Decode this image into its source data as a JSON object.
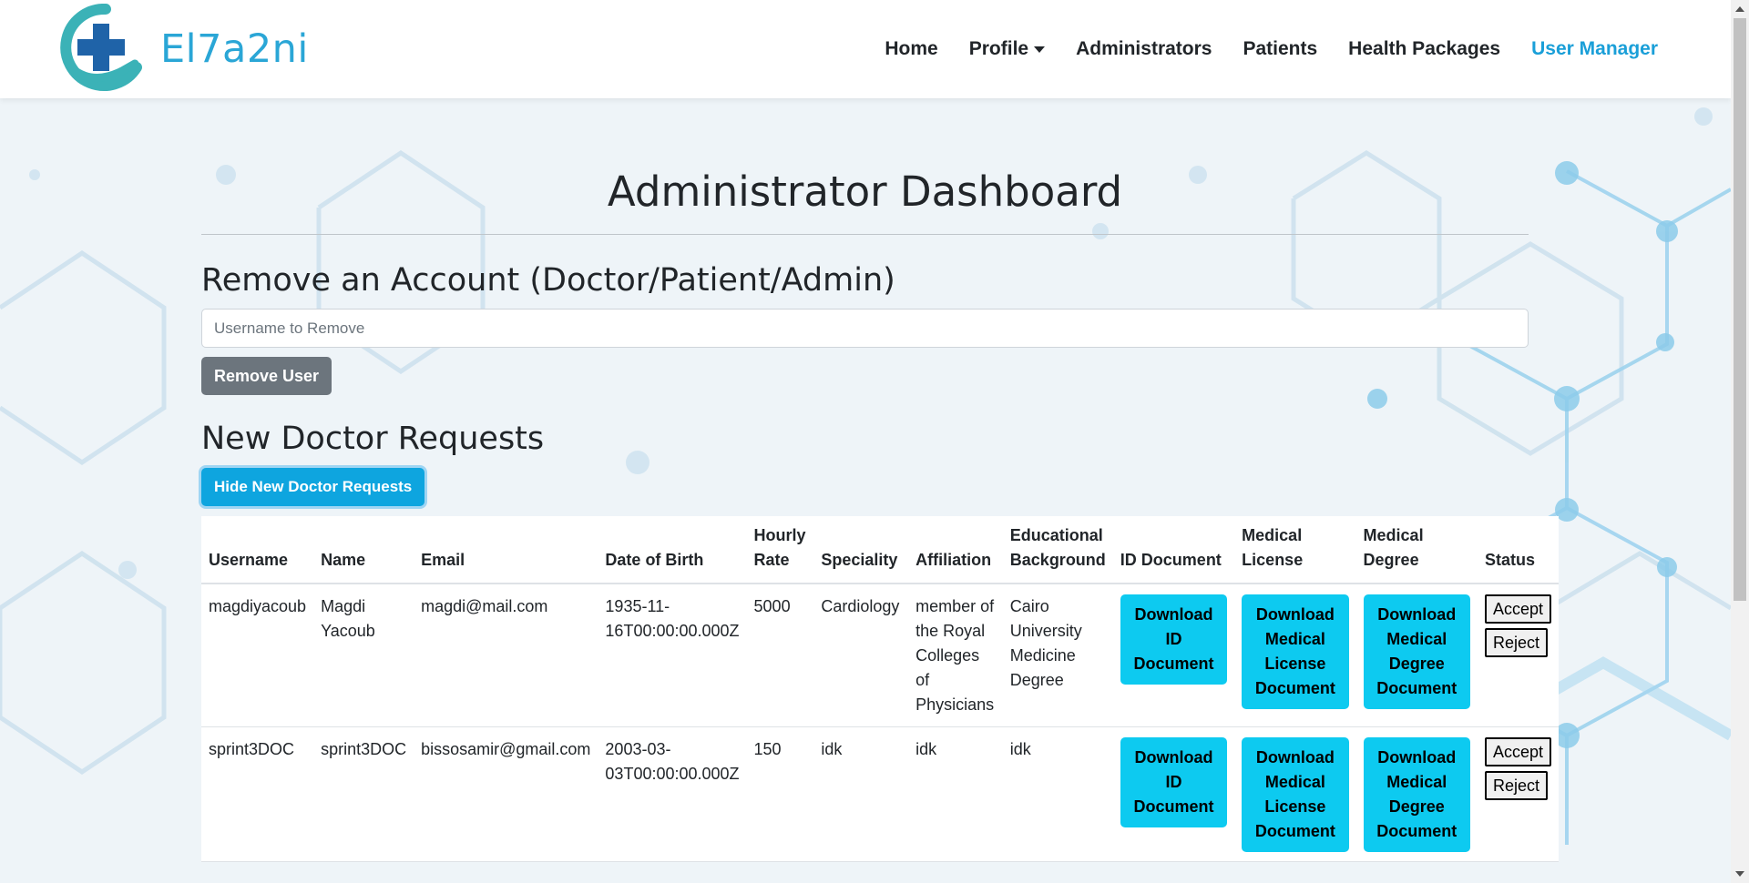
{
  "brand": {
    "name": "El7a2ni",
    "logo_icon": "medical-cross-hand-icon"
  },
  "nav": {
    "home": "Home",
    "profile": "Profile",
    "administrators": "Administrators",
    "patients": "Patients",
    "health_packages": "Health Packages",
    "user_manager": "User Manager"
  },
  "page": {
    "title": "Administrator Dashboard",
    "remove_section": {
      "heading": "Remove an Account (Doctor/Patient/Admin)",
      "input_placeholder": "Username to Remove",
      "input_value": "",
      "button": "Remove User"
    },
    "requests_section": {
      "heading": "New Doctor Requests",
      "toggle_button": "Hide New Doctor Requests"
    }
  },
  "table": {
    "headers": {
      "username": "Username",
      "name": "Name",
      "email": "Email",
      "dob": "Date of Birth",
      "rate": "Hourly Rate",
      "speciality": "Speciality",
      "affiliation": "Affiliation",
      "education": "Educational Background",
      "id_doc": "ID Document",
      "license": "Medical License",
      "degree": "Medical Degree",
      "status": "Status"
    },
    "buttons": {
      "download_id": "Download ID Document",
      "download_license": "Download Medical License Document",
      "download_degree": "Download Medical Degree Document",
      "accept": "Accept",
      "reject": "Reject"
    },
    "rows": [
      {
        "username": "magdiyacoub",
        "name": "Magdi Yacoub",
        "email": "magdi@mail.com",
        "dob": "1935-11-16T00:00:00.000Z",
        "rate": "5000",
        "speciality": "Cardiology",
        "affiliation": "member of the Royal Colleges of Physicians",
        "education": "Cairo University Medicine Degree"
      },
      {
        "username": "sprint3DOC",
        "name": "sprint3DOC",
        "email": "bissosamir@gmail.com",
        "dob": "2003-03-03T00:00:00.000Z",
        "rate": "150",
        "speciality": "idk",
        "affiliation": "idk",
        "education": "idk"
      }
    ]
  },
  "colors": {
    "brand": "#2aa6d6",
    "nav_active": "#1a9fd8",
    "remove_button": "#6c757d",
    "toggle_button": "#0ea5df",
    "download_button": "#0dcaf0"
  }
}
